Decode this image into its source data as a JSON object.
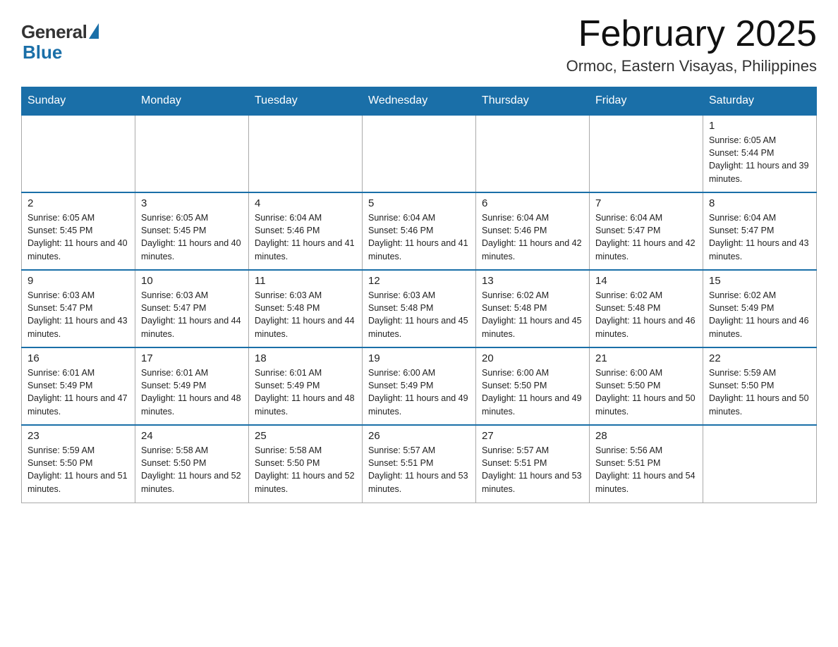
{
  "logo": {
    "general": "General",
    "blue": "Blue"
  },
  "header": {
    "title": "February 2025",
    "subtitle": "Ormoc, Eastern Visayas, Philippines"
  },
  "days_of_week": [
    "Sunday",
    "Monday",
    "Tuesday",
    "Wednesday",
    "Thursday",
    "Friday",
    "Saturday"
  ],
  "weeks": [
    {
      "days": [
        {
          "number": "",
          "info": ""
        },
        {
          "number": "",
          "info": ""
        },
        {
          "number": "",
          "info": ""
        },
        {
          "number": "",
          "info": ""
        },
        {
          "number": "",
          "info": ""
        },
        {
          "number": "",
          "info": ""
        },
        {
          "number": "1",
          "info": "Sunrise: 6:05 AM\nSunset: 5:44 PM\nDaylight: 11 hours and 39 minutes."
        }
      ]
    },
    {
      "days": [
        {
          "number": "2",
          "info": "Sunrise: 6:05 AM\nSunset: 5:45 PM\nDaylight: 11 hours and 40 minutes."
        },
        {
          "number": "3",
          "info": "Sunrise: 6:05 AM\nSunset: 5:45 PM\nDaylight: 11 hours and 40 minutes."
        },
        {
          "number": "4",
          "info": "Sunrise: 6:04 AM\nSunset: 5:46 PM\nDaylight: 11 hours and 41 minutes."
        },
        {
          "number": "5",
          "info": "Sunrise: 6:04 AM\nSunset: 5:46 PM\nDaylight: 11 hours and 41 minutes."
        },
        {
          "number": "6",
          "info": "Sunrise: 6:04 AM\nSunset: 5:46 PM\nDaylight: 11 hours and 42 minutes."
        },
        {
          "number": "7",
          "info": "Sunrise: 6:04 AM\nSunset: 5:47 PM\nDaylight: 11 hours and 42 minutes."
        },
        {
          "number": "8",
          "info": "Sunrise: 6:04 AM\nSunset: 5:47 PM\nDaylight: 11 hours and 43 minutes."
        }
      ]
    },
    {
      "days": [
        {
          "number": "9",
          "info": "Sunrise: 6:03 AM\nSunset: 5:47 PM\nDaylight: 11 hours and 43 minutes."
        },
        {
          "number": "10",
          "info": "Sunrise: 6:03 AM\nSunset: 5:47 PM\nDaylight: 11 hours and 44 minutes."
        },
        {
          "number": "11",
          "info": "Sunrise: 6:03 AM\nSunset: 5:48 PM\nDaylight: 11 hours and 44 minutes."
        },
        {
          "number": "12",
          "info": "Sunrise: 6:03 AM\nSunset: 5:48 PM\nDaylight: 11 hours and 45 minutes."
        },
        {
          "number": "13",
          "info": "Sunrise: 6:02 AM\nSunset: 5:48 PM\nDaylight: 11 hours and 45 minutes."
        },
        {
          "number": "14",
          "info": "Sunrise: 6:02 AM\nSunset: 5:48 PM\nDaylight: 11 hours and 46 minutes."
        },
        {
          "number": "15",
          "info": "Sunrise: 6:02 AM\nSunset: 5:49 PM\nDaylight: 11 hours and 46 minutes."
        }
      ]
    },
    {
      "days": [
        {
          "number": "16",
          "info": "Sunrise: 6:01 AM\nSunset: 5:49 PM\nDaylight: 11 hours and 47 minutes."
        },
        {
          "number": "17",
          "info": "Sunrise: 6:01 AM\nSunset: 5:49 PM\nDaylight: 11 hours and 48 minutes."
        },
        {
          "number": "18",
          "info": "Sunrise: 6:01 AM\nSunset: 5:49 PM\nDaylight: 11 hours and 48 minutes."
        },
        {
          "number": "19",
          "info": "Sunrise: 6:00 AM\nSunset: 5:49 PM\nDaylight: 11 hours and 49 minutes."
        },
        {
          "number": "20",
          "info": "Sunrise: 6:00 AM\nSunset: 5:50 PM\nDaylight: 11 hours and 49 minutes."
        },
        {
          "number": "21",
          "info": "Sunrise: 6:00 AM\nSunset: 5:50 PM\nDaylight: 11 hours and 50 minutes."
        },
        {
          "number": "22",
          "info": "Sunrise: 5:59 AM\nSunset: 5:50 PM\nDaylight: 11 hours and 50 minutes."
        }
      ]
    },
    {
      "days": [
        {
          "number": "23",
          "info": "Sunrise: 5:59 AM\nSunset: 5:50 PM\nDaylight: 11 hours and 51 minutes."
        },
        {
          "number": "24",
          "info": "Sunrise: 5:58 AM\nSunset: 5:50 PM\nDaylight: 11 hours and 52 minutes."
        },
        {
          "number": "25",
          "info": "Sunrise: 5:58 AM\nSunset: 5:50 PM\nDaylight: 11 hours and 52 minutes."
        },
        {
          "number": "26",
          "info": "Sunrise: 5:57 AM\nSunset: 5:51 PM\nDaylight: 11 hours and 53 minutes."
        },
        {
          "number": "27",
          "info": "Sunrise: 5:57 AM\nSunset: 5:51 PM\nDaylight: 11 hours and 53 minutes."
        },
        {
          "number": "28",
          "info": "Sunrise: 5:56 AM\nSunset: 5:51 PM\nDaylight: 11 hours and 54 minutes."
        },
        {
          "number": "",
          "info": ""
        }
      ]
    }
  ]
}
